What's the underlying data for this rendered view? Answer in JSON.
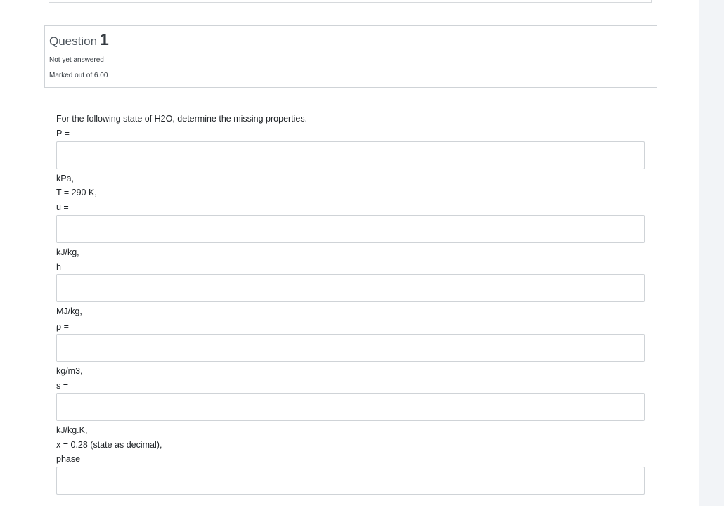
{
  "question_info": {
    "label": "Question",
    "number": "1",
    "state": "Not yet answered",
    "grade": "Marked out of 6.00"
  },
  "question_text": {
    "intro": "For the following state of H2O, determine the missing properties.",
    "p_label": "P =",
    "p_unit": "kPa,",
    "t_line": "T = 290 K,",
    "u_label": "u =",
    "u_unit": "kJ/kg,",
    "h_label": "h =",
    "h_unit": "MJ/kg,",
    "rho_label": "ρ =",
    "rho_unit": "kg/m3,",
    "s_label": "s =",
    "s_unit": "kJ/kg.K,",
    "x_line": "x = 0.28 (state as decimal),",
    "phase_label": "phase ="
  },
  "answers": {
    "p": "",
    "u": "",
    "h": "",
    "rho": "",
    "s": "",
    "phase": ""
  }
}
